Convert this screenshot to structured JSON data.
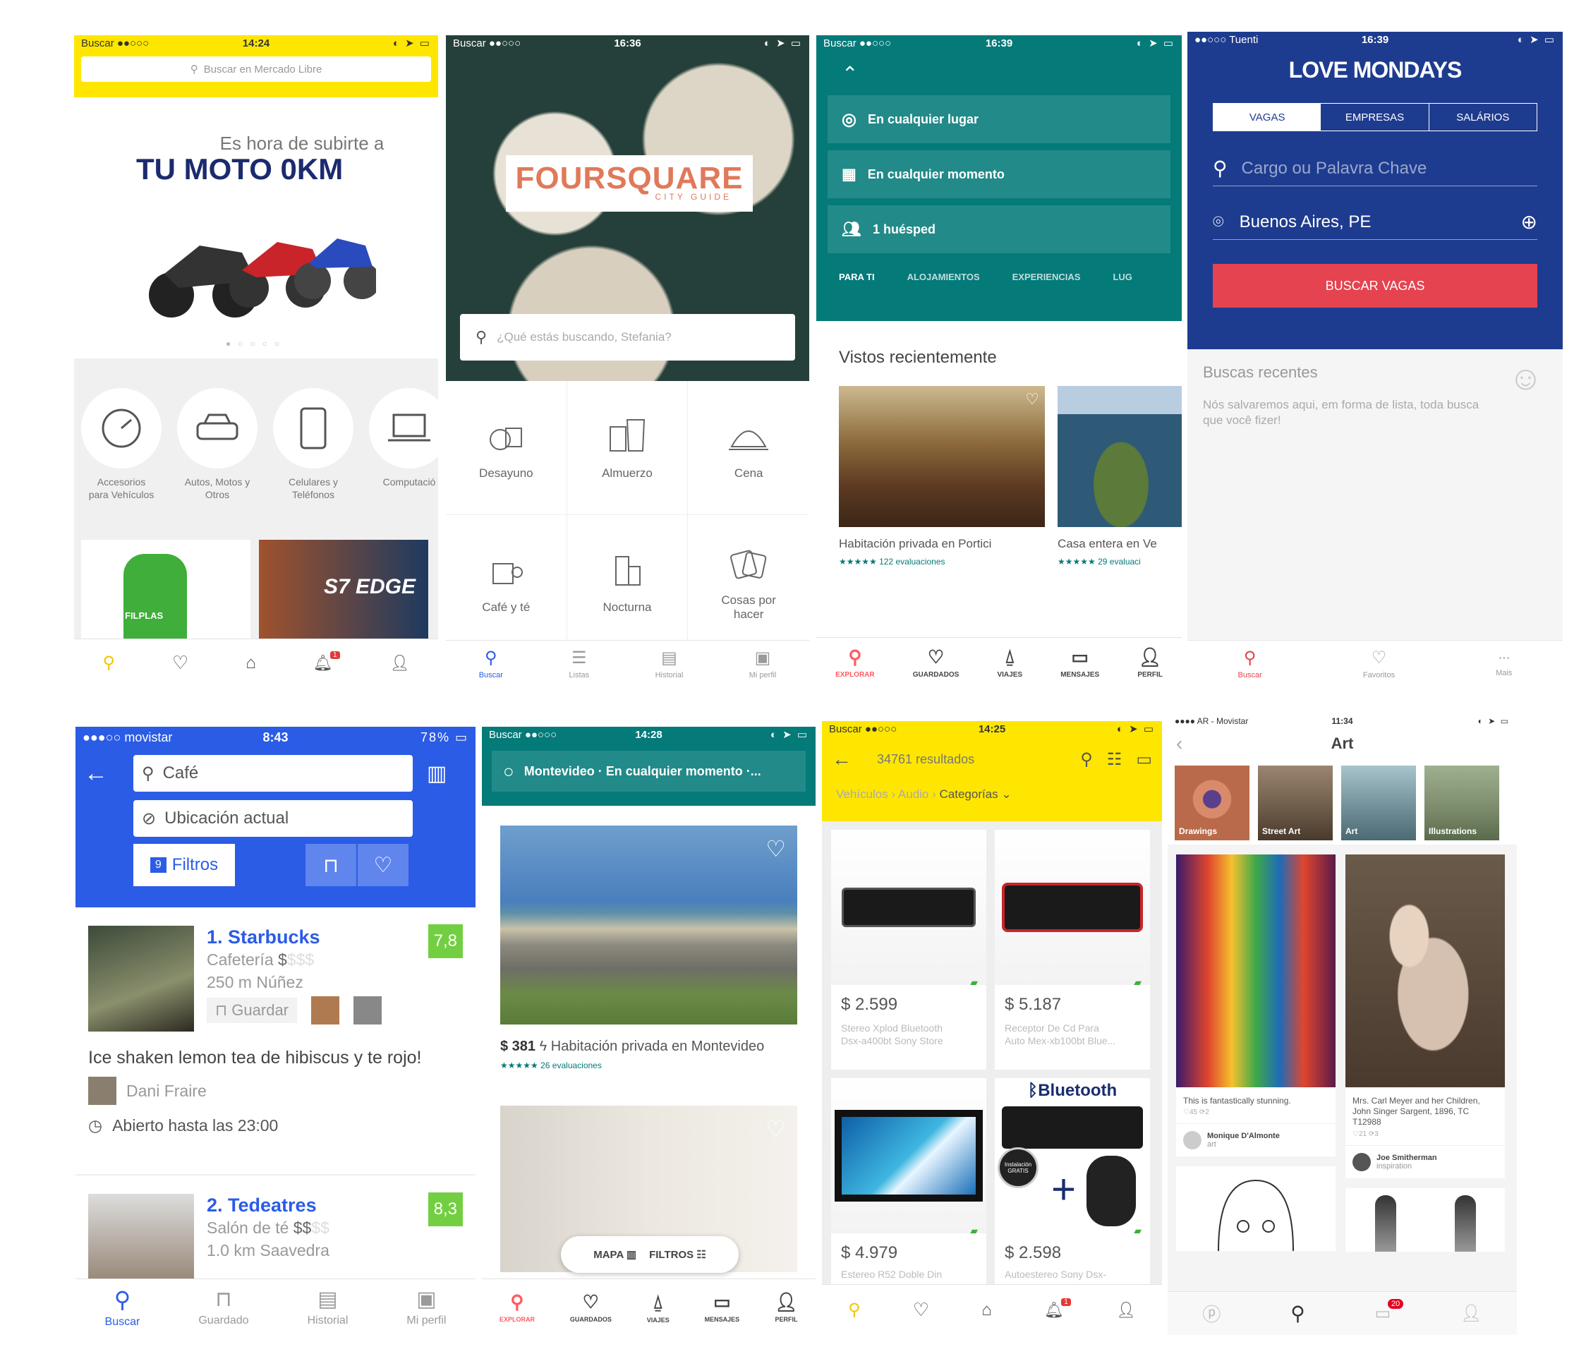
{
  "ml": {
    "status": {
      "carrier": "Buscar ●●○○○",
      "time": "14:24"
    },
    "search_placeholder": "Buscar en Mercado Libre",
    "banner_line1": "Es hora de subirte a",
    "banner_line2": "TU MOTO 0KM",
    "categories": [
      {
        "icon": "gauge-icon",
        "label1": "Accesorios",
        "label2": "para Vehículos"
      },
      {
        "icon": "car-icon",
        "label1": "Autos, Motos y",
        "label2": "Otros"
      },
      {
        "icon": "phone-icon",
        "label1": "Celulares y",
        "label2": "Teléfonos"
      },
      {
        "icon": "laptop-icon",
        "label1": "Computació",
        "label2": ""
      }
    ],
    "product1_label": "FILPLAS",
    "product2_label": "S7 EDGE",
    "badge": "1"
  },
  "fsq": {
    "status": {
      "carrier": "Buscar ●●○○○",
      "time": "16:36"
    },
    "logo": "FOURSQUARE",
    "logo_sub": "CITY GUIDE",
    "search_placeholder": "¿Qué estás buscando, Stefania?",
    "cells": [
      "Desayuno",
      "Almuerzo",
      "Cena",
      "Café y té",
      "Nocturna",
      "Cosas por hacer"
    ],
    "tabs": [
      "Buscar",
      "Listas",
      "Historial",
      "Mi perfil"
    ]
  },
  "abnb": {
    "status": {
      "carrier": "Buscar ●●○○○",
      "time": "16:39"
    },
    "rows": [
      "En cualquier lugar",
      "En cualquier momento",
      "1 huésped"
    ],
    "tabs": [
      "PARA TI",
      "ALOJAMIENTOS",
      "EXPERIENCIAS",
      "LUG"
    ],
    "section": "Vistos recientemente",
    "card1_title": "Habitación privada en Portici",
    "card1_reviews": "★★★★★ 122 evaluaciones",
    "card2_title": "Casa entera en Ve",
    "card2_reviews": "★★★★★ 29 evaluaci",
    "bottom_tabs": [
      "EXPLORAR",
      "GUARDADOS",
      "VIAJES",
      "MENSAJES",
      "PERFIL"
    ]
  },
  "lm": {
    "status": {
      "carrier": "●●○○○ Tuenti",
      "time": "16:39"
    },
    "logo": "LOVE MONDAYS",
    "seg": [
      "VAGAS",
      "EMPRESAS",
      "SALÁRIOS"
    ],
    "search_placeholder": "Cargo ou Palavra Chave",
    "location": "Buenos Aires, PE",
    "button": "BUSCAR VAGAS",
    "recent_title": "Buscas recentes",
    "recent_text": "Nós salvaremos aqui, em forma de lista, toda busca que você fizer!",
    "tabs": [
      "Buscar",
      "Favoritos",
      "Mais"
    ]
  },
  "fsq2": {
    "status": {
      "carrier": "●●●○○ movistar",
      "time": "8:43",
      "battery": "78%"
    },
    "search": "Café",
    "location": "Ubicación actual",
    "filters_count": "9",
    "filters": "Filtros",
    "v1": {
      "name": "1. Starbucks",
      "cat": "Cafetería",
      "price": "$",
      "price_dim": "$$$",
      "dist": "250 m",
      "area": "Núñez",
      "score": "7,8",
      "save": "Guardar"
    },
    "tip": "Ice shaken lemon tea de hibiscus y te rojo!",
    "tip_user": "Dani Fraire",
    "hours": "Abierto hasta las 23:00",
    "v2": {
      "name": "2. Tedeatres",
      "cat": "Salón de té",
      "price": "$$",
      "price_dim": "$$",
      "dist": "1.0 km",
      "area": "Saavedra",
      "score": "8,3"
    },
    "tabs": [
      "Buscar",
      "Guardado",
      "Historial",
      "Mi perfil"
    ]
  },
  "abnb2": {
    "status": {
      "carrier": "Buscar ●●○○○",
      "time": "14:28"
    },
    "search": "Montevideo · En cualquier momento ·...",
    "price": "$ 381",
    "title": "Habitación privada en Montevideo",
    "reviews": "★★★★★ 26 evaluaciones",
    "map": "MAPA",
    "filters": "FILTROS",
    "bottom_tabs": [
      "EXPLORAR",
      "GUARDADOS",
      "VIAJES",
      "MENSAJES",
      "PERFIL"
    ]
  },
  "ml2": {
    "status": {
      "carrier": "Buscar ●●○○○",
      "time": "14:25"
    },
    "results": "34761 resultados",
    "crumb1": "Vehículos",
    "crumb2": "Audio",
    "crumb3": "Categorías",
    "items": [
      {
        "price": "$ 2.599",
        "desc1": "Stereo Xplod Bluetooth",
        "desc2": "Dsx-a400bt Sony Store"
      },
      {
        "price": "$ 5.187",
        "desc1": "Receptor De Cd Para",
        "desc2": "Auto Mex-xb100bt Blue..."
      },
      {
        "price": "$ 4.979",
        "desc1": "Estereo R52 Doble Din",
        "desc2": ""
      },
      {
        "price": "$ 2.598",
        "desc1": "Autoestereo Sony Dsx-",
        "desc2": ""
      }
    ],
    "bt_label": "Bluetooth",
    "free_install": "Instalación GRATIS",
    "badge": "1"
  },
  "pin": {
    "status": {
      "carrier": "●●●● AR - Movistar",
      "time": "11:34"
    },
    "title": "Art",
    "chips": [
      "Drawings",
      "Street Art",
      "Art",
      "Illustrations"
    ],
    "pin1": {
      "desc": "This is fantastically stunning.",
      "stats": "♡45 ⟳2",
      "user": "Monique D'Almonte",
      "board": "art"
    },
    "pin2": {
      "desc": "Mrs. Carl Meyer and her Children, John Singer Sargent, 1896, TC T12988",
      "stats": "♡21 ⟳3",
      "user": "Joe Smitherman",
      "board": "inspiration"
    },
    "badge": "20"
  }
}
